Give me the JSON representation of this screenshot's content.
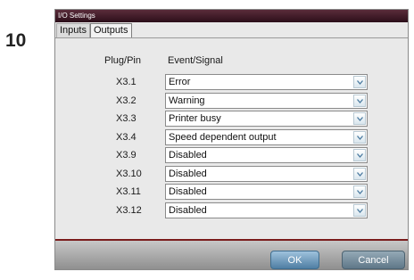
{
  "step_number": "10",
  "dialog": {
    "title": "I/O Settings",
    "tabs": [
      {
        "label": "Inputs"
      },
      {
        "label": "Outputs",
        "active": true
      }
    ],
    "columns": {
      "plug_pin": "Plug/Pin",
      "event_signal": "Event/Signal"
    },
    "rows": [
      {
        "pin": "X3.1",
        "value": "Error"
      },
      {
        "pin": "X3.2",
        "value": "Warning"
      },
      {
        "pin": "X3.3",
        "value": "Printer busy"
      },
      {
        "pin": "X3.4",
        "value": "Speed dependent output"
      },
      {
        "pin": "X3.9",
        "value": "Disabled"
      },
      {
        "pin": "X3.10",
        "value": "Disabled"
      },
      {
        "pin": "X3.11",
        "value": "Disabled"
      },
      {
        "pin": "X3.12",
        "value": "Disabled"
      }
    ],
    "buttons": {
      "ok": "OK",
      "cancel": "Cancel"
    }
  },
  "icons": {
    "dropdown": "chevron-down-icon"
  },
  "colors": {
    "title_bar": "#3d1a26",
    "accent_line": "#7a1c1c",
    "ok_button": "#6f9bbd",
    "cancel_button": "#7a93a3"
  }
}
